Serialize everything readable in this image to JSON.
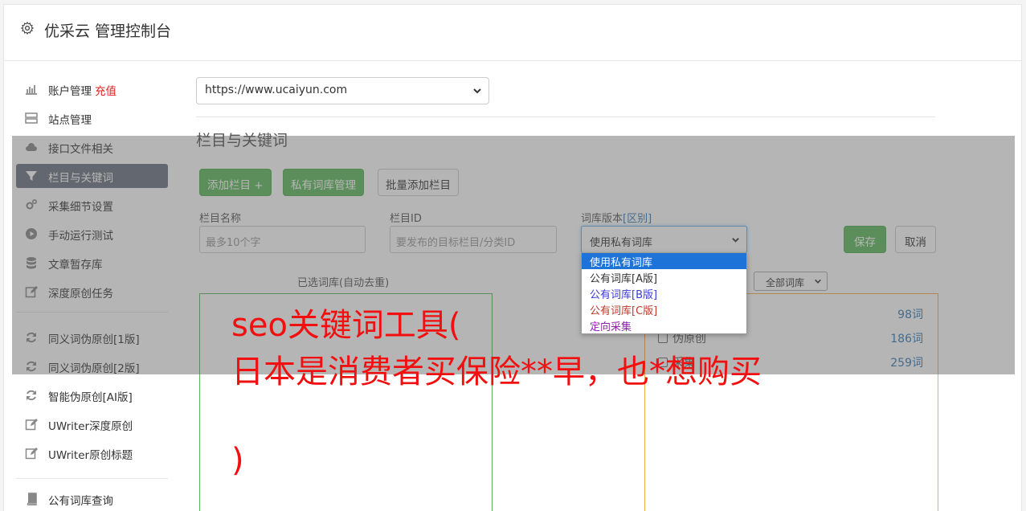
{
  "header": {
    "title": "优采云 管理控制台",
    "icon": "gear-icon"
  },
  "sidebar": {
    "items": [
      {
        "label": "账户管理",
        "extra": "充值",
        "icon": "bar-chart-icon"
      },
      {
        "label": "站点管理",
        "icon": "server-icon"
      },
      {
        "label": "接口文件相关",
        "icon": "cloud-upload-icon"
      },
      {
        "label": "栏目与关键词",
        "icon": "filter-icon",
        "active": true
      },
      {
        "label": "采集细节设置",
        "icon": "gears-icon"
      },
      {
        "label": "手动运行测试",
        "icon": "play-circle-icon"
      },
      {
        "label": "文章暂存库",
        "icon": "database-icon"
      },
      {
        "label": "深度原创任务",
        "icon": "edit-icon"
      },
      {
        "label": "同义词伪原创[1版]",
        "icon": "refresh-icon"
      },
      {
        "label": "同义词伪原创[2版]",
        "icon": "refresh-icon"
      },
      {
        "label": "智能伪原创[AI版]",
        "icon": "refresh-icon"
      },
      {
        "label": "UWriter深度原创",
        "icon": "edit-icon"
      },
      {
        "label": "UWriter原创标题",
        "icon": "edit-icon"
      },
      {
        "label": "公有词库查询",
        "icon": "book-icon"
      }
    ]
  },
  "main": {
    "site_select": "https://www.ucaiyun.com",
    "section_title": "栏目与关键词",
    "buttons": {
      "add_column": "添加栏目 +",
      "private_lib": "私有词库管理",
      "batch_add": "批量添加栏目",
      "save": "保存",
      "cancel": "取消"
    },
    "form": {
      "name_label": "栏目名称",
      "name_placeholder": "最多10个字",
      "id_label": "栏目ID",
      "id_placeholder": "要发布的目标栏目/分类ID",
      "version_label": "词库版本",
      "version_link": "[区别]",
      "version_selected": "使用私有词库",
      "version_options": [
        {
          "label": "使用私有词库",
          "color": "#ffffff"
        },
        {
          "label": "公有词库[A版]",
          "color": "#333333"
        },
        {
          "label": "公有词库[B版]",
          "color": "#3b3bd6"
        },
        {
          "label": "公有词库[C版]",
          "color": "#c0392b"
        },
        {
          "label": "定向采集",
          "color": "#8e24aa"
        }
      ]
    },
    "selected_title": "已选词库(自动去重)",
    "filter_select": "全部词库",
    "libraries": [
      {
        "name": "",
        "count": "98词"
      },
      {
        "name": "伪原创",
        "count": "186词"
      },
      {
        "name": "采集",
        "count": "259词"
      }
    ]
  },
  "overlay_text": {
    "line1": "seo关键词工具(",
    "line2": "日本是消费者买保险**早，也*想购买",
    "line3": ")"
  }
}
